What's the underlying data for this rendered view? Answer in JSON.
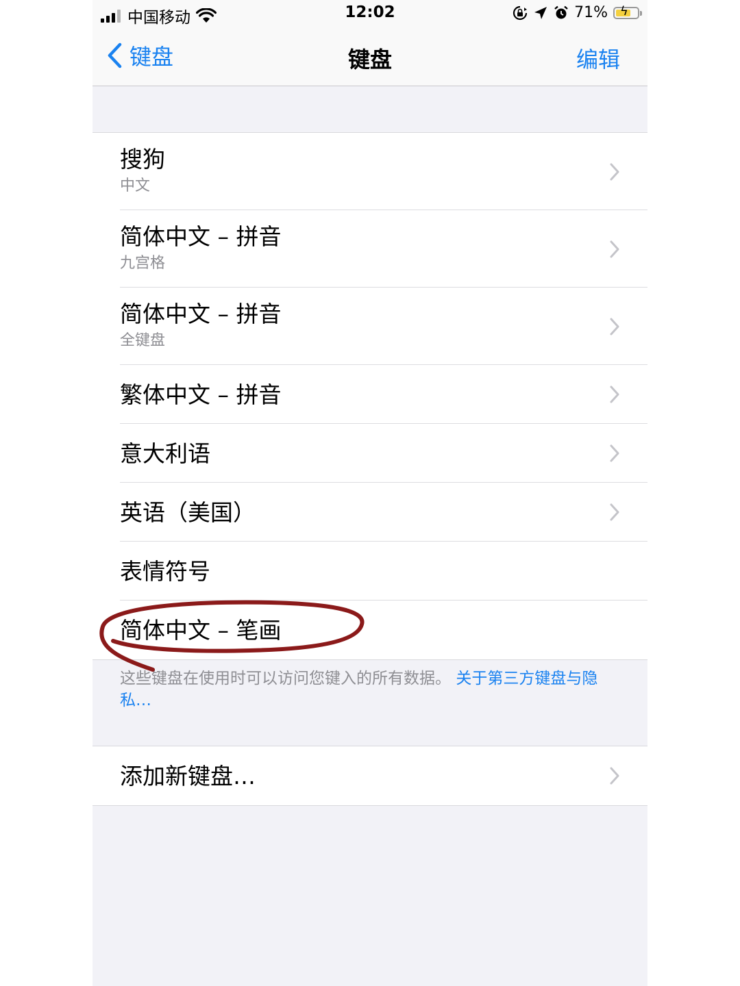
{
  "status_bar": {
    "carrier": "中国移动",
    "time": "12:02",
    "battery": "71%",
    "battery_level": 0.71
  },
  "nav": {
    "back_label": "键盘",
    "title": "键盘",
    "edit_label": "编辑"
  },
  "keyboards": [
    {
      "title": "搜狗",
      "subtitle": "中文"
    },
    {
      "title": "简体中文 – 拼音",
      "subtitle": "九宫格"
    },
    {
      "title": "简体中文 – 拼音",
      "subtitle": "全键盘"
    },
    {
      "title": "繁体中文 – 拼音"
    },
    {
      "title": "意大利语"
    },
    {
      "title": "英语（美国）"
    },
    {
      "title": "表情符号"
    },
    {
      "title": "简体中文 – 笔画"
    }
  ],
  "footer": {
    "note": "这些键盘在使用时可以访问您键入的所有数据。 ",
    "link": "关于第三方键盘与隐私…"
  },
  "add_keyboard": {
    "label": "添加新键盘…"
  },
  "colors": {
    "accent": "#1a82f0",
    "annotation": "#8b1a1a"
  }
}
